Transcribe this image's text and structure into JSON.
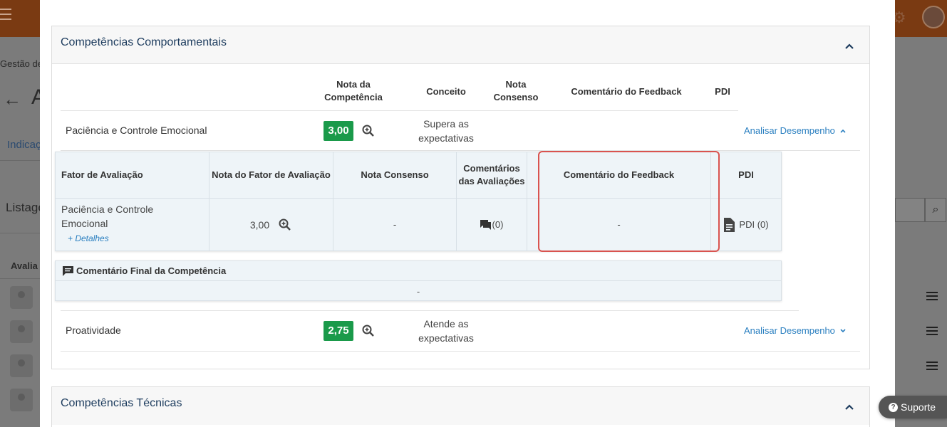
{
  "background": {
    "breadcrumb": "Gestão de",
    "title": "A",
    "tab": "Indicaç",
    "list_title": "Listage",
    "table_head": "Avalia"
  },
  "modal": {
    "panels": [
      {
        "title": "Competências Comportamentais",
        "columns": {
          "nota_competencia": "Nota da Competência",
          "conceito": "Conceito",
          "nota_consenso": "Nota Consenso",
          "comentario_feedback": "Comentário do Feedback",
          "pdi": "PDI"
        },
        "rows": [
          {
            "name": "Paciência e Controle Emocional",
            "score": "3,00",
            "concept": "Supera as expectativas",
            "analyze": "Analisar Desempenho",
            "expanded": true
          },
          {
            "name": "Proatividade",
            "score": "2,75",
            "concept": "Atende as expectativas",
            "analyze": "Analisar Desempenho",
            "expanded": false
          }
        ],
        "detail": {
          "headers": {
            "fator": "Fator de Avaliação",
            "nota_fator": "Nota do Fator de Avaliação",
            "nota_consenso": "Nota Consenso",
            "comentarios": "Comentários das Avaliações",
            "comentario_feedback": "Comentário do Feedback",
            "pdi": "PDI"
          },
          "row": {
            "fator": "Paciência e Controle Emocional",
            "detalhes": "+ Detalhes",
            "nota_fator": "3,00",
            "nota_consenso": "-",
            "comentarios": "(0)",
            "comentario_feedback": "-",
            "pdi": "PDI (0)"
          },
          "final_comment_label": "Comentário Final da Competência",
          "final_comment_value": "-"
        }
      },
      {
        "title": "Competências Técnicas"
      }
    ]
  },
  "support_button": "Suporte",
  "colors": {
    "score_badge": "#1a9a4a",
    "link": "#2a7fc0",
    "highlight": "#d9534f",
    "panel_title": "#1d3c5e"
  }
}
